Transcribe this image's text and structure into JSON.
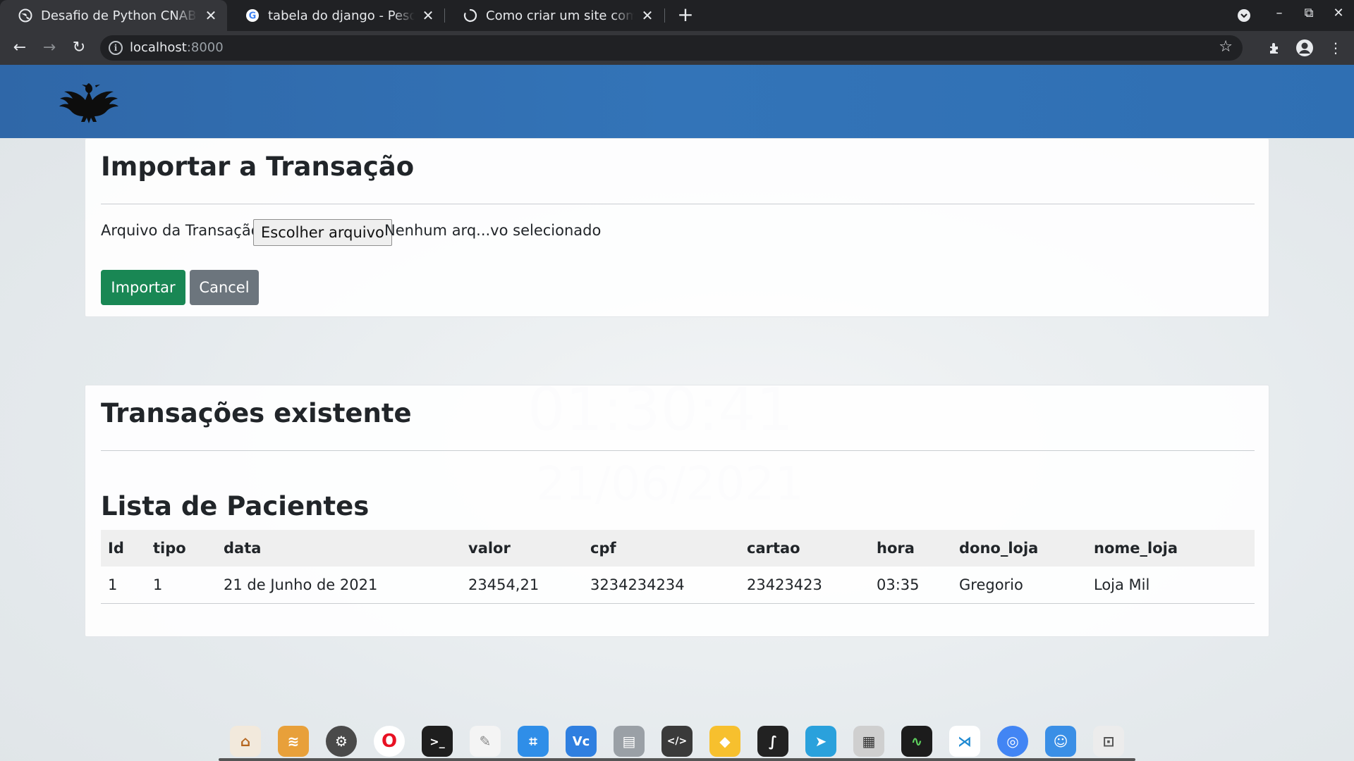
{
  "browser": {
    "tabs": [
      {
        "title": "Desafio de Python CNAB",
        "active": true
      },
      {
        "title": "tabela do django - Pesquisa Google",
        "active": false
      },
      {
        "title": "Como criar um site com formulário",
        "active": false
      }
    ],
    "url_host": "localhost",
    "url_port": ":8000"
  },
  "header": {
    "logo": "eagle-logo"
  },
  "import_card": {
    "title": "Importar a Transação",
    "file_label": "Arquivo da Transação:",
    "file_button": "Escolher arquivo",
    "file_status": "Nenhum arq...vo selecionado",
    "submit_label": "Importar",
    "cancel_label": "Cancel"
  },
  "list_card": {
    "title": "Transações existente",
    "subtitle": "Lista de Pacientes",
    "columns": [
      "Id",
      "tipo",
      "data",
      "valor",
      "cpf",
      "cartao",
      "hora",
      "dono_loja",
      "nome_loja"
    ],
    "rows": [
      [
        "1",
        "1",
        "21 de Junho de 2021",
        "23454,21",
        "3234234234",
        "23423423",
        "03:35",
        "Gregorio",
        "Loja Mil"
      ]
    ]
  },
  "background_overlay": {
    "time": "01:30:41",
    "date": "21/06/2021"
  },
  "colors": {
    "header": "#3374b8",
    "primary": "#198754",
    "secondary": "#6c757d"
  }
}
